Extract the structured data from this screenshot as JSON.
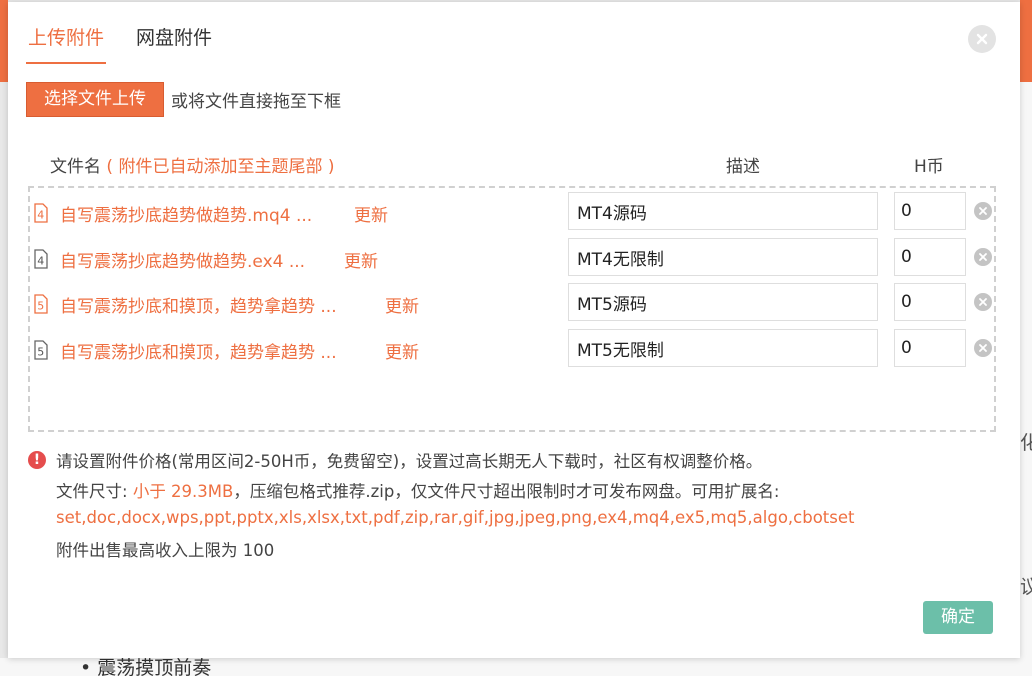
{
  "dialog": {
    "tabs": [
      {
        "label": "上传附件",
        "active": true
      },
      {
        "label": "网盘附件",
        "active": false
      }
    ],
    "upload_button": "选择文件上传",
    "upload_hint": "或将文件直接拖至下框",
    "columns": {
      "filename": "文件名",
      "filename_note": "( 附件已自动添加至主题尾部 )",
      "description": "描述",
      "price": "H币"
    },
    "files": [
      {
        "icon": "4",
        "name": "自写震荡抄底趋势做趋势.mq4 ...",
        "update": "更新",
        "description": "MT4源码",
        "price": "0"
      },
      {
        "icon": "4",
        "name": "自写震荡抄底趋势做趋势.ex4 ...",
        "update": "更新",
        "description": "MT4无限制",
        "price": "0"
      },
      {
        "icon": "5",
        "name": "自写震荡抄底和摸顶，趋势拿趋势 ...",
        "update": "更新",
        "description": "MT5源码",
        "price": "0"
      },
      {
        "icon": "5",
        "name": "自写震荡抄底和摸顶，趋势拿趋势 ...",
        "update": "更新",
        "description": "MT5无限制",
        "price": "0"
      }
    ],
    "notes": {
      "line1": "请设置附件价格(常用区间2-50H币，免费留空)，设置过高长期无人下载时，社区有权调整价格。",
      "line2_prefix": "文件尺寸: ",
      "line2_size": "小于 29.3MB",
      "line2_suffix": "，压缩包格式推荐.zip，仅文件尺寸超出限制时才可发布网盘。可用扩展名:",
      "extensions": "set,doc,docx,wps,ppt,pptx,xls,xlsx,txt,pdf,zip,rar,gif,jpg,jpeg,png,ex4,mq4,ex5,mq5,algo,cbotset",
      "line4": "附件出售最高收入上限为 100"
    },
    "confirm_button": "确定"
  },
  "background": {
    "bottom_text": "• 震荡摸顶前奏",
    "right_chars": [
      "化",
      "议"
    ]
  },
  "colors": {
    "accent": "#ee6f41",
    "confirm": "#6cbfa9",
    "warning": "#e54d4d"
  }
}
